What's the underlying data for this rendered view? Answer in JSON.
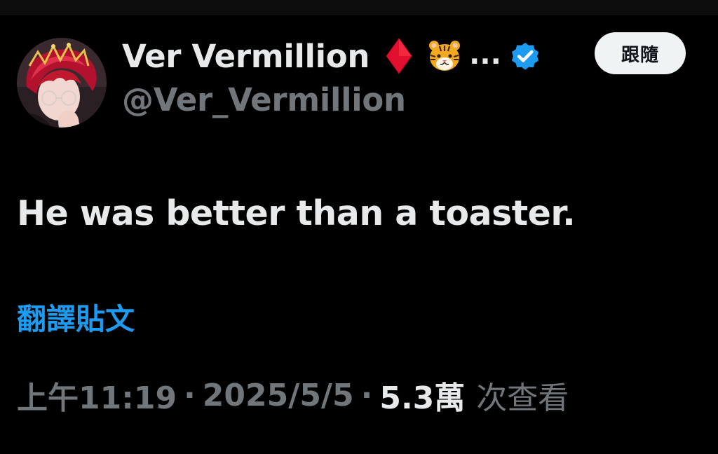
{
  "author": {
    "display_name": "Ver Vermillion",
    "handle": "@Ver_Vermillion",
    "badges": [
      "red-diamond-icon",
      "tiger-face-icon",
      "verified-badge-icon"
    ],
    "truncation": "...",
    "follow_label": "跟隨"
  },
  "tweet": {
    "text": "He was better than a toaster.",
    "translate_label": "翻譯貼文"
  },
  "meta": {
    "time": "上午11:19",
    "separator": "·",
    "date": "2025/5/5",
    "views_count": "5.3萬",
    "views_label": "次查看"
  },
  "colors": {
    "background": "#000000",
    "primary_text": "#e7e9ea",
    "secondary_text": "#71767b",
    "link": "#1d9bf0",
    "follow_button_bg": "#eff3f4",
    "diamond": "#e0102e",
    "verified": "#1d9bf0"
  }
}
